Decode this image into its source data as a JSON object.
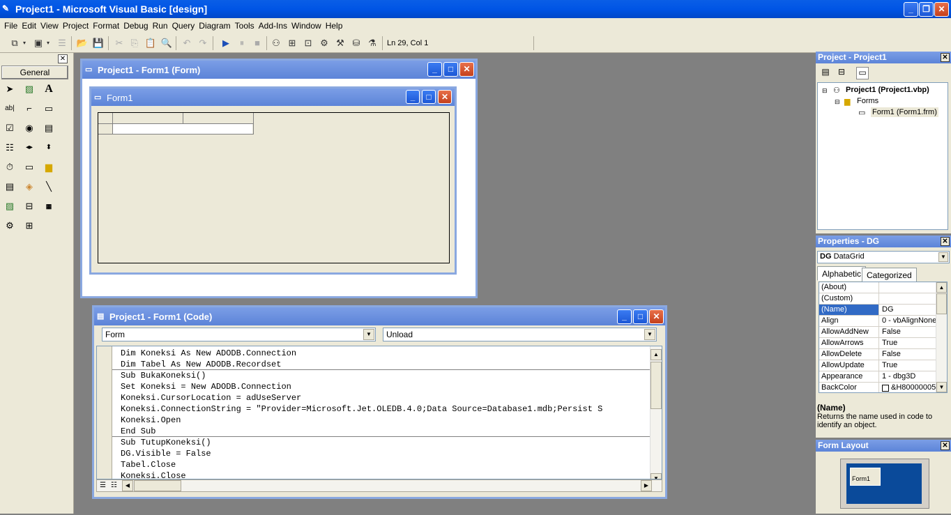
{
  "app": {
    "title": "Project1 - Microsoft Visual Basic [design]"
  },
  "menu": [
    "File",
    "Edit",
    "View",
    "Project",
    "Format",
    "Debug",
    "Run",
    "Query",
    "Diagram",
    "Tools",
    "Add-Ins",
    "Window",
    "Help"
  ],
  "toolbar": {
    "status": "Ln 29, Col 1"
  },
  "toolbox": {
    "header": "General"
  },
  "form_window": {
    "title": "Project1 - Form1 (Form)",
    "inner_title": "Form1"
  },
  "code_window": {
    "title": "Project1 - Form1 (Code)",
    "object_combo": "Form",
    "proc_combo": "Unload",
    "lines": [
      "Dim Koneksi As New ADODB.Connection",
      "Dim Tabel As New ADODB.Recordset",
      "Sub BukaKoneksi()",
      "Set Koneksi = New ADODB.Connection",
      "Koneksi.CursorLocation = adUseServer",
      "Koneksi.ConnectionString = \"Provider=Microsoft.Jet.OLEDB.4.0;Data Source=Database1.mdb;Persist S",
      "Koneksi.Open",
      "End Sub",
      "Sub TutupKoneksi()",
      "DG.Visible = False",
      "Tabel.Close",
      "Koneksi.Close"
    ]
  },
  "project": {
    "title": "Project - Project1",
    "root": "Project1 (Project1.vbp)",
    "folder": "Forms",
    "item": "Form1 (Form1.frm)"
  },
  "properties": {
    "title": "Properties - DG",
    "object_name": "DG",
    "object_type": "DataGrid",
    "tabs": [
      "Alphabetic",
      "Categorized"
    ],
    "rows": [
      {
        "k": "(About)",
        "v": ""
      },
      {
        "k": "(Custom)",
        "v": ""
      },
      {
        "k": "(Name)",
        "v": "DG"
      },
      {
        "k": "Align",
        "v": "0 - vbAlignNone"
      },
      {
        "k": "AllowAddNew",
        "v": "False"
      },
      {
        "k": "AllowArrows",
        "v": "True"
      },
      {
        "k": "AllowDelete",
        "v": "False"
      },
      {
        "k": "AllowUpdate",
        "v": "True"
      },
      {
        "k": "Appearance",
        "v": "1 - dbg3D"
      },
      {
        "k": "BackColor",
        "v": "&H80000005"
      }
    ],
    "desc_title": "(Name)",
    "desc_text": "Returns the name used in code to identify an object."
  },
  "form_layout": {
    "title": "Form Layout",
    "preview_label": "Form1"
  }
}
